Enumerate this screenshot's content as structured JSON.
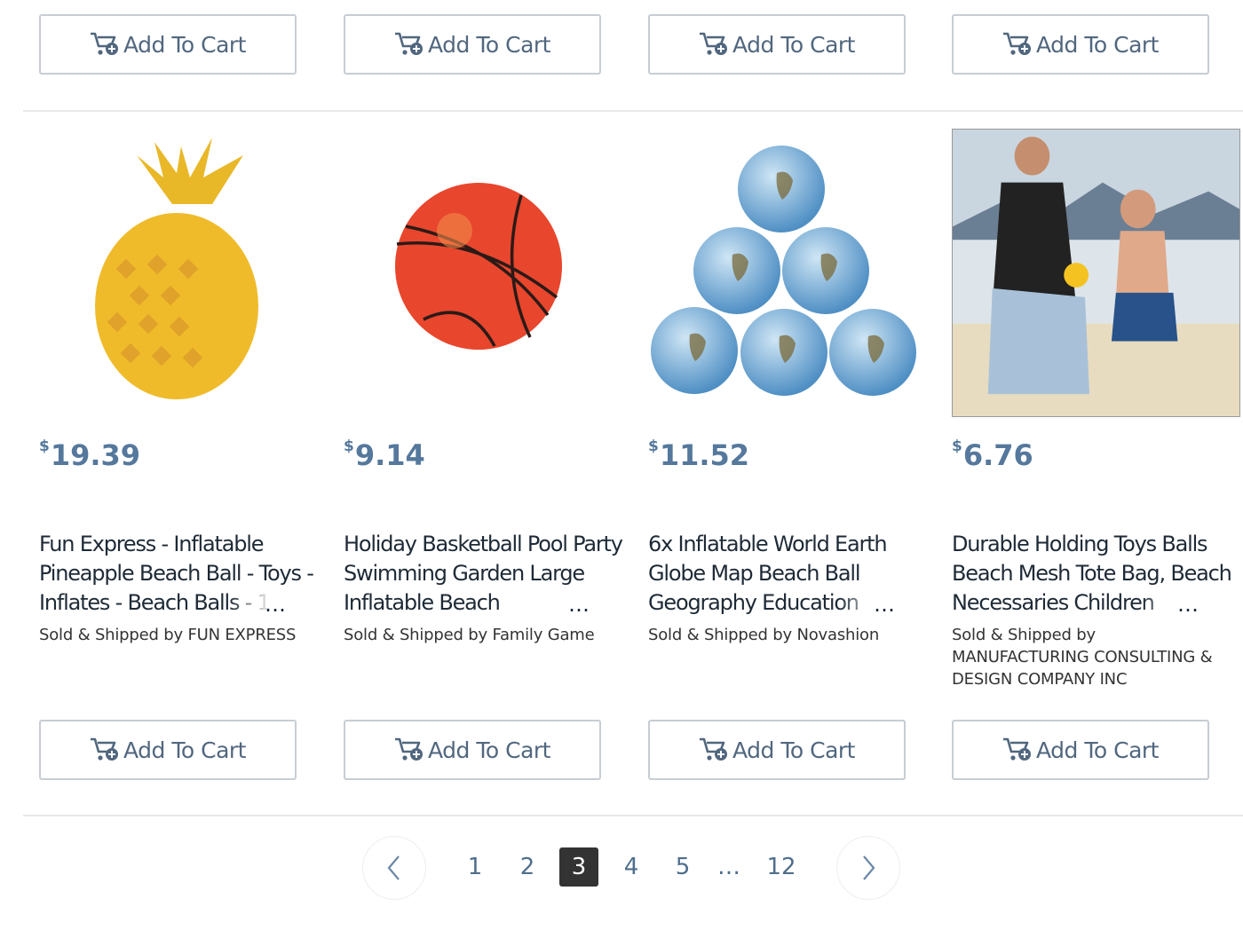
{
  "buttons": {
    "add_to_cart": "Add To Cart"
  },
  "colors": {
    "price": "#55789c",
    "button_text": "#51677f",
    "active_page_bg": "#333333"
  },
  "products": [
    {
      "price_symbol": "$",
      "price": "19.39",
      "title": "Fun Express - Inflatable Pineapple Beach Ball - Toys - Inflates - Beach Balls - 1",
      "seller": "Sold & Shipped by FUN EXPRESS",
      "image_icon": "pineapple-beach-ball"
    },
    {
      "price_symbol": "$",
      "price": "9.14",
      "title": "Holiday Basketball Pool Party Swimming Garden Large Inflatable Beach",
      "seller": "Sold & Shipped by Family Game",
      "image_icon": "basketball-beach-ball"
    },
    {
      "price_symbol": "$",
      "price": "11.52",
      "title": "6x Inflatable World Earth Globe Map Beach Ball Geography Education",
      "seller": "Sold & Shipped by Novashion",
      "image_icon": "globe-beach-balls"
    },
    {
      "price_symbol": "$",
      "price": "6.76",
      "title": "Durable Holding Toys Balls Beach Mesh Tote Bag, Beach Necessaries Children",
      "seller": "Sold & Shipped by MANUFACTURING CONSULTING & DESIGN COMPANY INC",
      "image_icon": "beach-mesh-tote-photo"
    }
  ],
  "ellipsis": "…",
  "pagination": {
    "pages": [
      "1",
      "2",
      "3",
      "4",
      "5"
    ],
    "gap": "…",
    "last": "12",
    "current": "3"
  }
}
